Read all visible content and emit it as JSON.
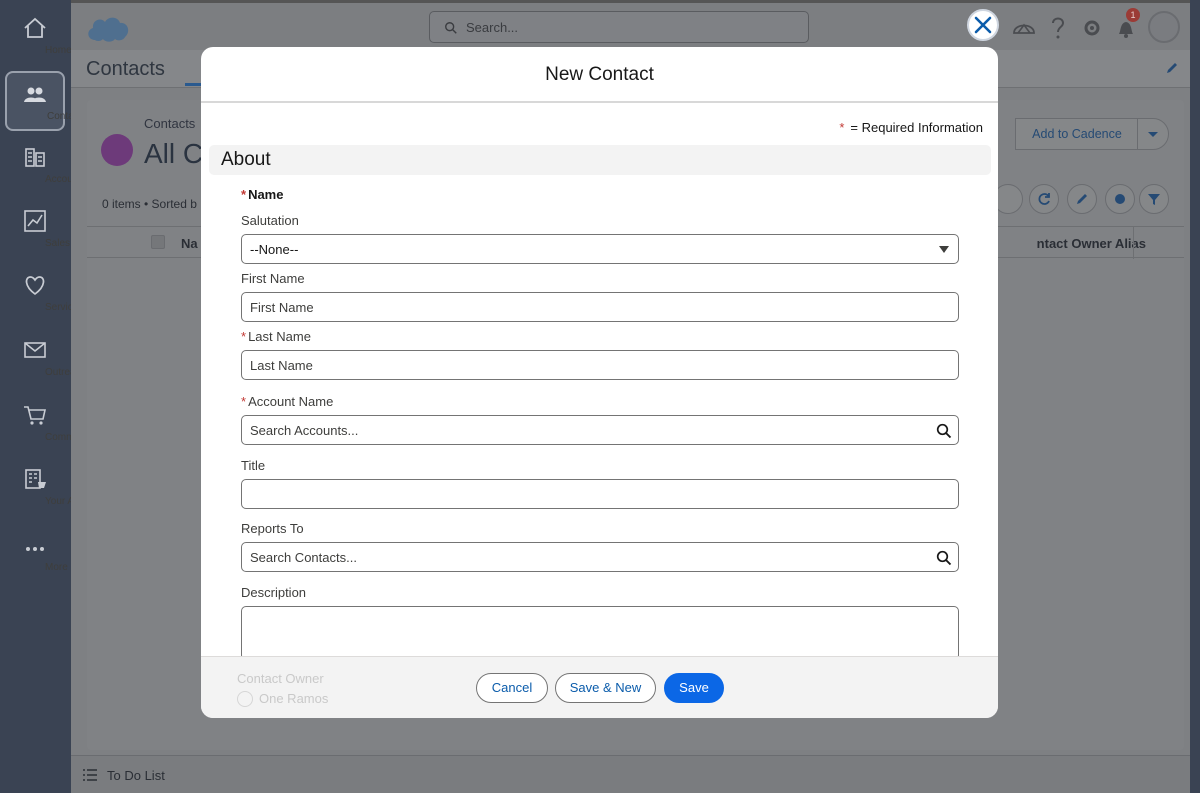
{
  "nav": {
    "items": [
      {
        "label": "Home",
        "icon": "home-icon"
      },
      {
        "label": "Contacts",
        "icon": "contacts-icon"
      },
      {
        "label": "Accounts",
        "icon": "accounts-icon"
      },
      {
        "label": "Sales",
        "icon": "sales-icon"
      },
      {
        "label": "Service",
        "icon": "service-icon"
      },
      {
        "label": "Outreach",
        "icon": "outreach-icon"
      },
      {
        "label": "Commerce",
        "icon": "commerce-icon"
      },
      {
        "label": "Your Acc...",
        "icon": "your-account-icon"
      },
      {
        "label": "More",
        "icon": "more-icon"
      }
    ],
    "active": "Contacts"
  },
  "header": {
    "search_placeholder": "Search...",
    "notification_count": "1"
  },
  "app": {
    "name": "Contacts",
    "breadcrumb": "Contacts",
    "list_title": "All Co",
    "items_meta": "0 items • Sorted b",
    "add_to_cadence": "Add to Cadence",
    "columns": [
      "Na",
      "ntact Owner Alias"
    ]
  },
  "todo": {
    "label": "To Do List"
  },
  "modal": {
    "title": "New Contact",
    "required_note": "= Required Information",
    "required_star": "*",
    "section": "About",
    "name_label": "Name",
    "fields": {
      "salutation": {
        "label": "Salutation",
        "value": "--None--"
      },
      "first_name": {
        "label": "First Name",
        "placeholder": "First Name"
      },
      "last_name": {
        "label": "Last Name",
        "placeholder": "Last Name"
      },
      "account_name": {
        "label": "Account Name",
        "placeholder": "Search Accounts..."
      },
      "title": {
        "label": "Title",
        "placeholder": ""
      },
      "reports_to": {
        "label": "Reports To",
        "placeholder": "Search Contacts..."
      },
      "description": {
        "label": "Description",
        "placeholder": ""
      }
    },
    "owner_label": "Contact Owner",
    "owner_name": "One Ramos",
    "buttons": {
      "cancel": "Cancel",
      "save_new": "Save & New",
      "save": "Save"
    }
  },
  "colors": {
    "primary": "#0b67e6",
    "link": "#0b5cab",
    "required": "#c23934",
    "nav_bg": "#3a4353"
  }
}
